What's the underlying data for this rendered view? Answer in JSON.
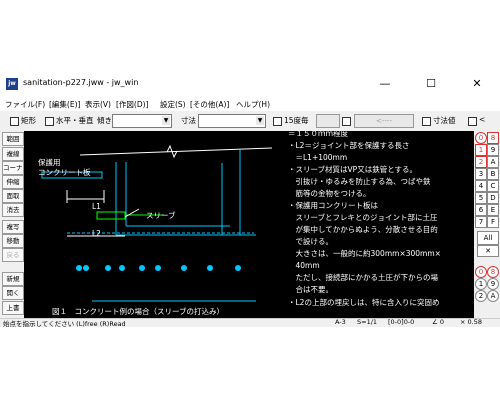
{
  "window": {
    "title": "sanitation-p227.jww - jw_win",
    "app_icon": "jw",
    "minimize": "—",
    "maximize": "☐",
    "close": "✕"
  },
  "menu": [
    "ファイル(F)",
    "[編集(E)]",
    "表示(V)",
    "[作図(D)]",
    "設定(S)",
    "[その他(A)]",
    "ヘルプ(H)"
  ],
  "toolbar": {
    "rect": "矩形",
    "hv": "水平・垂直",
    "slope": "傾き",
    "dim": "寸法",
    "deg15": "15度毎",
    "arrows": "<----",
    "dimval": "寸法値",
    "lt": "<"
  },
  "left_tools": [
    "範囲",
    "複線",
    "コーナー",
    "伸縮",
    "面取",
    "消去",
    "複写",
    "移動",
    "戻る",
    "新規",
    "開く",
    "上書"
  ],
  "right_tools": {
    "top": [
      {
        "l": "0",
        "r": "8"
      },
      {
        "l": "1",
        "r": "9"
      },
      {
        "l": "2",
        "r": "A"
      },
      {
        "l": "3",
        "r": "B"
      },
      {
        "l": "4",
        "r": "C"
      },
      {
        "l": "5",
        "r": "D"
      },
      {
        "l": "6",
        "r": "E"
      },
      {
        "l": "7",
        "r": "F"
      }
    ],
    "all": "All",
    "x": "✕",
    "bottom": [
      {
        "l": "0",
        "r": "8"
      },
      {
        "l": "1",
        "r": "9"
      },
      {
        "l": "2",
        "r": "A"
      }
    ]
  },
  "drawing": {
    "label_conc": [
      "保護用",
      "コンクリート板"
    ],
    "label_sleeve": "スリーブ",
    "label_l1": "L1",
    "label_l2": "L2",
    "caption": "図１　コンクリート例の場合（スリーブの打込み）",
    "notes": [
      "＝１５０ｍｍ程度",
      "・L2＝ジョイント部を保護する長さ",
      "　＝L1+100mm",
      "・スリーブ材質はVP又は鉄管とする。",
      "　引抜け・ゆるみを防止する為、つばや鉄",
      "　筋等の金物をつける。",
      "・保護用コンクリート板は",
      "　スリーブとフレキとのジョイント部に土圧",
      "　が集中してかからぬよう、分散させる目的",
      "　で設ける。",
      "　大きさは、一般的に約300mm×300mm×",
      "　40mm",
      "　ただし、接続部にかかる土圧が下からの場",
      "　合は不要。",
      "・L2の上部の埋戻しは、特に含入りに突固め"
    ]
  },
  "status": {
    "message": "始点を指示してください (L)free (R)Read",
    "paper": "A-3",
    "scale": "S=1/1",
    "layer": "[0-0]0-0",
    "angle": "∠ 0",
    "zoom": "× 0.58"
  }
}
